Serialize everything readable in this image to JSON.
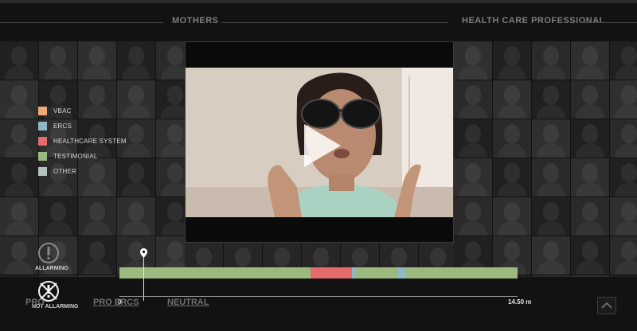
{
  "header": {
    "left_label": "MOTHERS",
    "right_label": "HEALTH CARE PROFESSIONAL"
  },
  "legend": {
    "items": [
      {
        "label": "VBAC",
        "color": "#f0a877"
      },
      {
        "label": "ERCS",
        "color": "#8fb8c6"
      },
      {
        "label": "HEALTHCARE SYSTEM",
        "color": "#e46b6b"
      },
      {
        "label": "TESTIMONIAL",
        "color": "#9cba7e"
      },
      {
        "label": "OTHER",
        "color": "#b2c4c2"
      }
    ]
  },
  "controls": {
    "alarming_label": "ALLARMING",
    "not_alarming_label": "NOT ALLARMING"
  },
  "tabs": [
    "PRO",
    "PRO ERCS",
    "NEUTRAL"
  ],
  "timeline": {
    "start_label": "0",
    "end_label": "14.50 m",
    "progress_fraction": 0.06,
    "segments": [
      {
        "category": "TESTIMONIAL",
        "start": 0.0,
        "end": 0.48,
        "color": "#9cba7e"
      },
      {
        "category": "HEALTHCARE SYSTEM",
        "start": 0.48,
        "end": 0.584,
        "color": "#e46b6b"
      },
      {
        "category": "ERCS",
        "start": 0.584,
        "end": 0.592,
        "color": "#8fb8c6"
      },
      {
        "category": "TESTIMONIAL",
        "start": 0.592,
        "end": 0.7,
        "color": "#9cba7e"
      },
      {
        "category": "ERCS",
        "start": 0.7,
        "end": 0.72,
        "color": "#8fb8c6"
      },
      {
        "category": "TESTIMONIAL",
        "start": 0.72,
        "end": 1.0,
        "color": "#9cba7e"
      }
    ]
  },
  "icons": {
    "play": "play-icon",
    "alarming": "exclamation-icon",
    "not_alarming": "crossed-exclamation-icon",
    "marker": "map-pin-icon",
    "scroll_top": "chevron-up-icon"
  }
}
